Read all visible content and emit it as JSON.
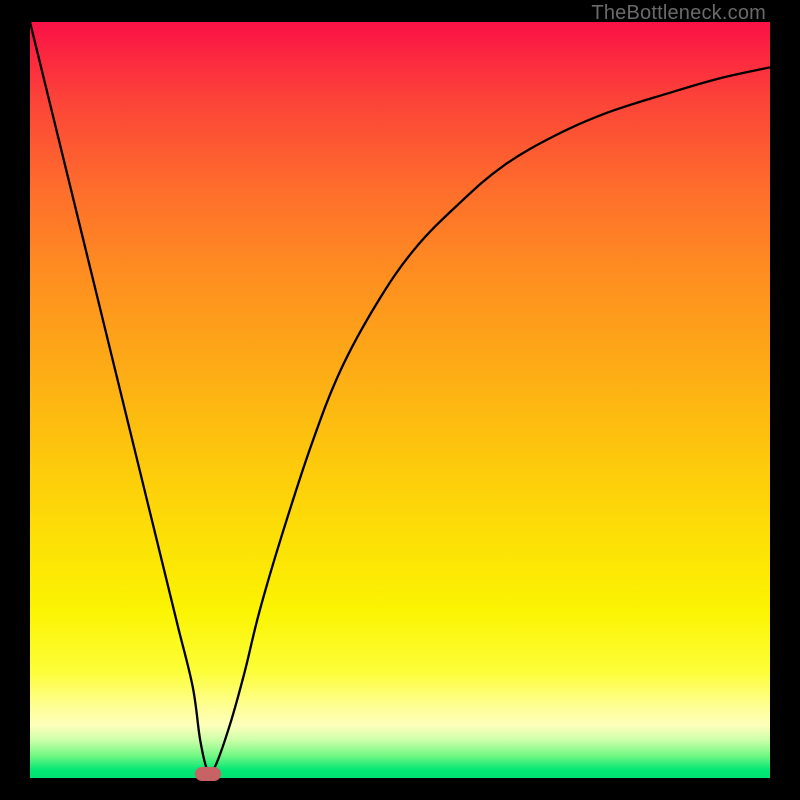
{
  "watermark": "TheBottleneck.com",
  "chart_data": {
    "type": "line",
    "title": "",
    "xlabel": "",
    "ylabel": "",
    "xlim": [
      0,
      100
    ],
    "ylim": [
      0,
      100
    ],
    "grid": false,
    "legend": false,
    "series": [
      {
        "name": "bottleneck-curve",
        "x": [
          0,
          2,
          4,
          6,
          8,
          10,
          12,
          14,
          16,
          18,
          20,
          22,
          23,
          24,
          25,
          27,
          29,
          31,
          34,
          38,
          42,
          47,
          52,
          58,
          64,
          71,
          78,
          86,
          93,
          100
        ],
        "y": [
          100,
          92,
          84,
          76,
          68,
          60,
          52,
          44,
          36,
          28,
          20,
          12,
          5,
          1,
          1.5,
          7,
          14,
          22,
          32,
          44,
          54,
          63,
          70,
          76,
          81,
          85,
          88,
          90.5,
          92.5,
          94
        ]
      }
    ],
    "marker": {
      "name": "optimal-point",
      "x": 24,
      "y": 0.5,
      "color": "#c76364"
    },
    "background_gradient": {
      "top": "#fb1146",
      "bottom": "#00e171"
    }
  }
}
